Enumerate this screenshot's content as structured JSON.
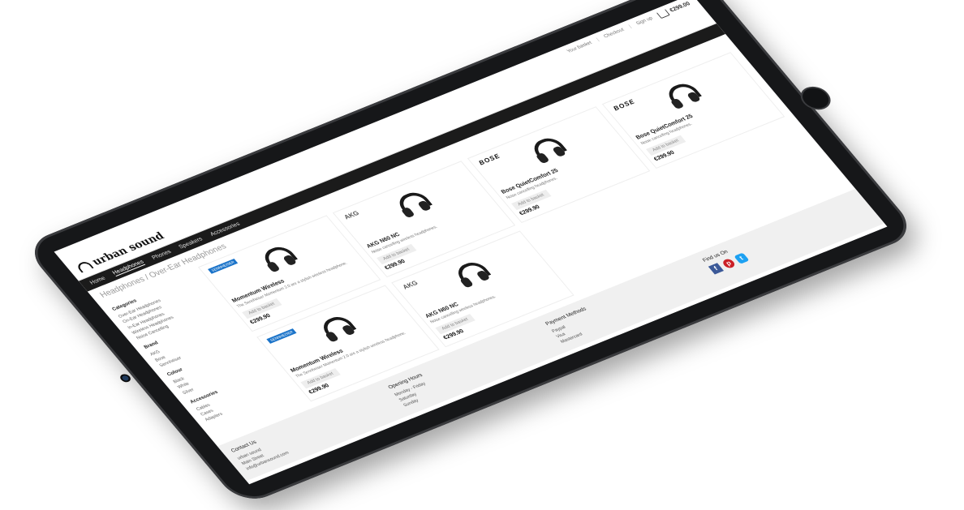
{
  "top_links": [
    "Your basket",
    "Checkout",
    "Sign up"
  ],
  "cart": {
    "amount": "€299.00"
  },
  "brand": {
    "name": "urban sound"
  },
  "nav": [
    "Home",
    "Headphones",
    "Phones",
    "Speakers",
    "Accessories"
  ],
  "breadcrumb": "Headphones / Over-Ear Headphones",
  "sidebar": {
    "sections": [
      {
        "title": "Categories",
        "items": [
          "Over-Ear Headphones",
          "On-Ear Headphones",
          "In-Ear Headphones",
          "Wireless Headphones",
          "Noise Cancelling"
        ]
      },
      {
        "title": "Brand",
        "items": [
          "AKG",
          "Bose",
          "Sennheiser"
        ]
      },
      {
        "title": "Colour",
        "items": [
          "Black",
          "White",
          "Silver"
        ]
      },
      {
        "title": "Accessories",
        "items": [
          "Cables",
          "Cases",
          "Adapters"
        ]
      }
    ]
  },
  "products": [
    {
      "brand": "",
      "badge": "SENNHEISER",
      "title": "Momentum Wireless",
      "desc": "The Sennheiser Momentum 2.0 are a stylish wireless headphone.",
      "add": "Add to basket",
      "price": "€299.90"
    },
    {
      "brand": "AKG",
      "badge": "",
      "title": "AKG N60 NC",
      "desc": "Noise cancelling wireless headphones.",
      "add": "Add to basket",
      "price": "€299.90"
    },
    {
      "brand": "BOSE",
      "badge": "",
      "title": "Bose QuietComfort 25",
      "desc": "Noise cancelling headphones.",
      "add": "Add to basket",
      "price": "€299.90"
    },
    {
      "brand": "BOSE",
      "badge": "",
      "title": "Bose QuietComfort 25",
      "desc": "Noise cancelling headphones.",
      "add": "Add to basket",
      "price": "€299.90"
    },
    {
      "brand": "",
      "badge": "SENNHEISER",
      "title": "Momentum Wireless",
      "desc": "The Sennheiser Momentum 2.0 are a stylish wireless headphone.",
      "add": "Add to basket",
      "price": "€299.90"
    },
    {
      "brand": "AKG",
      "badge": "",
      "title": "AKG N60 NC",
      "desc": "Noise cancelling wireless headphones.",
      "add": "Add to basket",
      "price": "€299.90"
    }
  ],
  "footer": {
    "contact": {
      "title": "Contact Us",
      "lines": [
        "urban sound",
        "Main Street",
        "info@urbansound.com"
      ]
    },
    "hours": {
      "title": "Opening Hours",
      "lines": [
        "Monday - Friday",
        "Saturday",
        "Sunday"
      ]
    },
    "payment": {
      "title": "Payment Methods",
      "lines": [
        "Paypal",
        "Visa",
        "Mastercard"
      ]
    },
    "social": {
      "title": "Find us On"
    }
  },
  "colors": {
    "nav_bg": "#1b1b1b",
    "accent": "#1a73c9"
  }
}
